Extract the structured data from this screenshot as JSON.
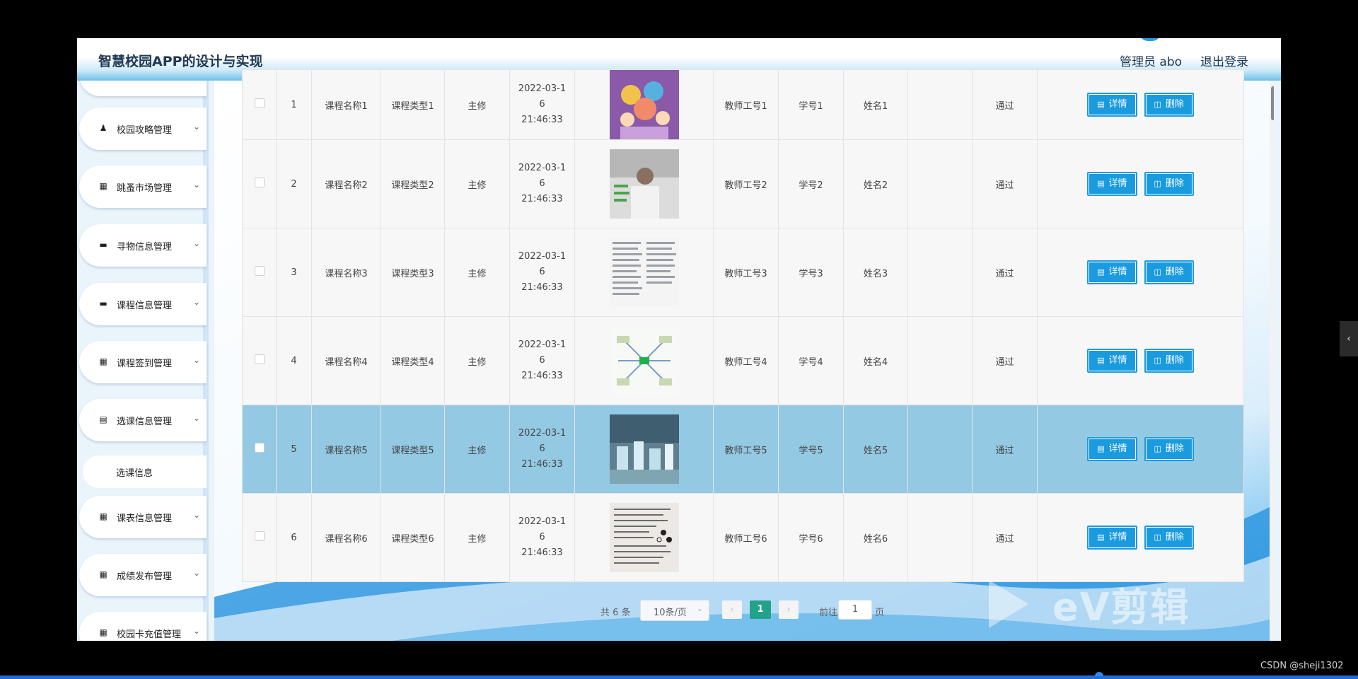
{
  "header": {
    "title": "智慧校园APP的设计与实现",
    "user": "管理员 abo",
    "logout": "退出登录"
  },
  "sidebar": {
    "items": [
      {
        "label": "校园攻略管理",
        "icon": "user-icon"
      },
      {
        "label": "跳蚤市场管理",
        "icon": "grid-icon"
      },
      {
        "label": "寻物信息管理",
        "icon": "monitor-icon"
      },
      {
        "label": "课程信息管理",
        "icon": "monitor-icon"
      },
      {
        "label": "课程签到管理",
        "icon": "grid-icon"
      },
      {
        "label": "选课信息管理",
        "icon": "chart-icon"
      },
      {
        "label": "课表信息管理",
        "icon": "grid-icon"
      },
      {
        "label": "成绩发布管理",
        "icon": "grid-icon"
      },
      {
        "label": "校园卡充值管理",
        "icon": "grid-icon"
      }
    ],
    "subitem": "选课信息"
  },
  "table": {
    "rows": [
      {
        "idx": "1",
        "course_name": "课程名称1",
        "course_type": "课程类型1",
        "kind": "主修",
        "time_a": "2022-03-1",
        "time_b": "6 21:46:33",
        "teacher_no": "教师工号1",
        "student_no": "学号1",
        "name": "姓名1",
        "status": "通过",
        "thumb": "cartoon-kids-image"
      },
      {
        "idx": "2",
        "course_name": "课程名称2",
        "course_type": "课程类型2",
        "kind": "主修",
        "time_a": "2022-03-1",
        "time_b": "6 21:46:33",
        "teacher_no": "教师工号2",
        "student_no": "学号2",
        "name": "姓名2",
        "status": "通过",
        "thumb": "classroom-poster-image"
      },
      {
        "idx": "3",
        "course_name": "课程名称3",
        "course_type": "课程类型3",
        "kind": "主修",
        "time_a": "2022-03-1",
        "time_b": "6 21:46:33",
        "teacher_no": "教师工号3",
        "student_no": "学号3",
        "name": "姓名3",
        "status": "通过",
        "thumb": "document-page-image"
      },
      {
        "idx": "4",
        "course_name": "课程名称4",
        "course_type": "课程类型4",
        "kind": "主修",
        "time_a": "2022-03-1",
        "time_b": "6 21:46:33",
        "teacher_no": "教师工号4",
        "student_no": "学号4",
        "name": "姓名4",
        "status": "通过",
        "thumb": "mind-map-image"
      },
      {
        "idx": "5",
        "course_name": "课程名称5",
        "course_type": "课程类型5",
        "kind": "主修",
        "time_a": "2022-03-1",
        "time_b": "6 21:46:33",
        "teacher_no": "教师工号5",
        "student_no": "学号5",
        "name": "姓名5",
        "status": "通过",
        "thumb": "lab-photo-image"
      },
      {
        "idx": "6",
        "course_name": "课程名称6",
        "course_type": "课程类型6",
        "kind": "主修",
        "time_a": "2022-03-1",
        "time_b": "6 21:46:33",
        "teacher_no": "教师工号6",
        "student_no": "学号6",
        "name": "姓名6",
        "status": "通过",
        "thumb": "worksheet-image"
      }
    ],
    "detail_label": "详情",
    "delete_label": "删除"
  },
  "pagination": {
    "total": "共 6 条",
    "page_size": "10条/页",
    "current": "1",
    "goto_label": "前往",
    "goto_value": "1",
    "page_suffix": "页",
    "prev_icon": "chevron-left-icon",
    "next_icon": "chevron-right-icon"
  },
  "overlay": {
    "watermark": "eV剪辑",
    "csdn": "CSDN @sheji1302"
  },
  "colors": {
    "accent": "#1a9be0",
    "page_active": "#21a28b",
    "selected_row": "#94c9e3"
  }
}
